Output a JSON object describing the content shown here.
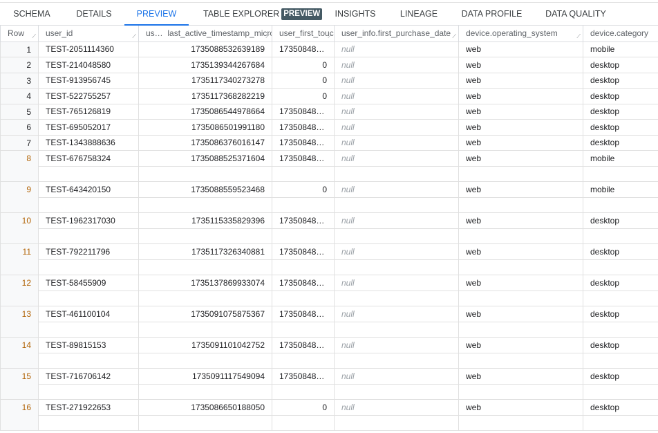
{
  "tabs": [
    {
      "label": "SCHEMA"
    },
    {
      "label": "DETAILS"
    },
    {
      "label": "PREVIEW",
      "active": true
    },
    {
      "label": "TABLE EXPLORER",
      "badge": "PREVIEW"
    },
    {
      "label": "INSIGHTS"
    },
    {
      "label": "LINEAGE"
    },
    {
      "label": "DATA PROFILE"
    },
    {
      "label": "DATA QUALITY"
    }
  ],
  "columns": [
    "Row",
    "user_id",
    "us…",
    "last_active_timestamp_micros",
    "user_first_touch",
    "user_info.first_purchase_date",
    "device.operating_system",
    "device.category"
  ],
  "rows": [
    {
      "n": "1",
      "id": "TEST-2051114360",
      "ts": "1735088532639189",
      "ft": "173508480…",
      "pd": "null",
      "os": "web",
      "cat": "mobile"
    },
    {
      "n": "2",
      "id": "TEST-214048580",
      "ts": "1735139344267684",
      "ft": "0",
      "pd": "null",
      "os": "web",
      "cat": "desktop"
    },
    {
      "n": "3",
      "id": "TEST-913956745",
      "ts": "1735117340273278",
      "ft": "0",
      "pd": "null",
      "os": "web",
      "cat": "desktop"
    },
    {
      "n": "4",
      "id": "TEST-522755257",
      "ts": "1735117368282219",
      "ft": "0",
      "pd": "null",
      "os": "web",
      "cat": "desktop"
    },
    {
      "n": "5",
      "id": "TEST-765126819",
      "ts": "1735086544978664",
      "ft": "173508480…",
      "pd": "null",
      "os": "web",
      "cat": "desktop"
    },
    {
      "n": "6",
      "id": "TEST-695052017",
      "ts": "1735086501991180",
      "ft": "173508480…",
      "pd": "null",
      "os": "web",
      "cat": "desktop"
    },
    {
      "n": "7",
      "id": "TEST-1343888636",
      "ts": "1735086376016147",
      "ft": "173508480…",
      "pd": "null",
      "os": "web",
      "cat": "desktop"
    },
    {
      "n": "8",
      "id": "TEST-676758324",
      "ts": "1735088525371604",
      "ft": "173508480…",
      "pd": "null",
      "os": "web",
      "cat": "mobile"
    },
    {
      "n": "9",
      "id": "TEST-643420150",
      "ts": "1735088559523468",
      "ft": "0",
      "pd": "null",
      "os": "web",
      "cat": "mobile"
    },
    {
      "n": "10",
      "id": "TEST-1962317030",
      "ts": "1735115335829396",
      "ft": "173508480…",
      "pd": "null",
      "os": "web",
      "cat": "desktop"
    },
    {
      "n": "11",
      "id": "TEST-792211796",
      "ts": "1735117326340881",
      "ft": "173508480…",
      "pd": "null",
      "os": "web",
      "cat": "desktop"
    },
    {
      "n": "12",
      "id": "TEST-58455909",
      "ts": "1735137869933074",
      "ft": "173508480…",
      "pd": "null",
      "os": "web",
      "cat": "desktop"
    },
    {
      "n": "13",
      "id": "TEST-461100104",
      "ts": "1735091075875367",
      "ft": "173508480…",
      "pd": "null",
      "os": "web",
      "cat": "desktop"
    },
    {
      "n": "14",
      "id": "TEST-89815153",
      "ts": "1735091101042752",
      "ft": "173508480…",
      "pd": "null",
      "os": "web",
      "cat": "desktop"
    },
    {
      "n": "15",
      "id": "TEST-716706142",
      "ts": "1735091117549094",
      "ft": "173508480…",
      "pd": "null",
      "os": "web",
      "cat": "desktop"
    },
    {
      "n": "16",
      "id": "TEST-271922653",
      "ts": "1735086650188050",
      "ft": "0",
      "pd": "null",
      "os": "web",
      "cat": "desktop"
    }
  ]
}
